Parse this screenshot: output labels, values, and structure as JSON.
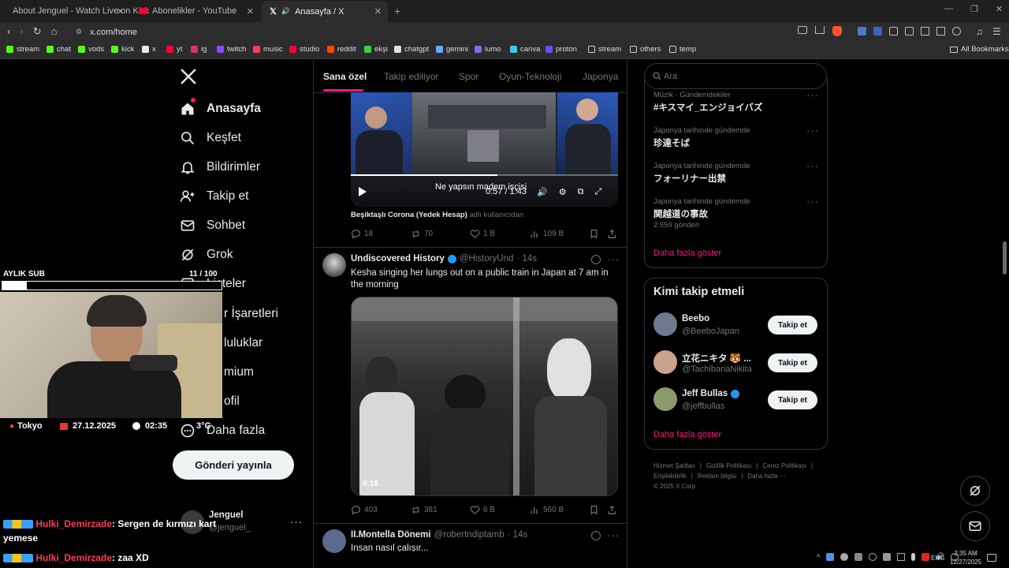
{
  "browser": {
    "tabs": [
      {
        "title": "About Jenguel - Watch Live on Kick",
        "active": false
      },
      {
        "title": "Abonelikler - YouTube",
        "active": false
      },
      {
        "title": "Anasayfa / X",
        "active": true
      }
    ],
    "url": "x.com/home",
    "bookmarks": [
      "stream",
      "chat",
      "vods",
      "kick",
      "x",
      "yt",
      "ig",
      "twitch",
      "music",
      "studio",
      "reddit",
      "ekşi",
      "chatgpt",
      "gemini",
      "lumo",
      "canva",
      "proton",
      "stream",
      "others",
      "temp"
    ],
    "all_bookmarks": "All Bookmarks"
  },
  "nav": {
    "home": "Anasayfa",
    "explore": "Keşfet",
    "notifications": "Bildirimler",
    "follow": "Takip et",
    "chat": "Sohbet",
    "grok": "Grok",
    "lists": "Listeler",
    "bookmarks": "r İşaretleri",
    "communities": "luluklar",
    "premium": "mium",
    "profile": "ofil",
    "more": "Daha fazla",
    "post_button": "Gönderi yayınla",
    "account_name": "Jenguel",
    "account_handle": "@jenguel_"
  },
  "feed": {
    "tabs": [
      "Sana özel",
      "Takip ediliyor",
      "Spor",
      "Oyun-Teknoloji",
      "Japonya"
    ],
    "post1": {
      "caption": "Ne yapsın madem işçisi",
      "time": "0:57 / 1:43",
      "attribution_user": "Beşiktaşlı Corona (Yedek Hesap)",
      "attribution_suffix": "adlı kullanıcıdan",
      "replies": "18",
      "reposts": "70",
      "likes": "1 B",
      "views": "109 B",
      "progress": 0.55
    },
    "post2": {
      "name": "Undiscovered History",
      "handle": "@HistoryUnd",
      "age": "· 14s",
      "text": "Kesha singing her lungs out on a public train in Japan at 7 am in the morning",
      "video_time": "0:16",
      "replies": "403",
      "reposts": "381",
      "likes": "6 B",
      "views": "560 B"
    },
    "post3": {
      "name": "II.Montella Dönemi",
      "handle": "@robertndiptamb",
      "age": "· 14s",
      "text": "İnsan nasıl çalışır..."
    }
  },
  "sidebar": {
    "search_placeholder": "Ara",
    "trends": [
      {
        "meta": "Müzik · Gündemdekiler",
        "title": "#キスマイ_エンジョイバズ",
        "count": ""
      },
      {
        "meta": "Japonya tarihinde gündemde",
        "title": "珍達そば",
        "count": ""
      },
      {
        "meta": "Japonya tarihinde gündemde",
        "title": "フォーリナー出禁",
        "count": ""
      },
      {
        "meta": "Japonya tarihinde gündemde",
        "title": "関越道の事故",
        "count": "2.559 gönderi"
      }
    ],
    "show_more": "Daha fazla göster",
    "who_to_follow_title": "Kimi takip etmeli",
    "who_to_follow": [
      {
        "name": "Beebo",
        "handle": "@BeeboJapan",
        "button": "Takip et"
      },
      {
        "name": "立花ニキタ 🐯 ...",
        "handle": "@TachibanaNikita",
        "button": "Takip et"
      },
      {
        "name": "Jeff Bullas",
        "handle": "@jeffbullas",
        "button": "Takip et"
      }
    ],
    "show_more2": "Daha fazla göster",
    "footer": [
      "Hizmet Şartları",
      "|",
      "Gizlilik Politikası",
      "|",
      "Çerez Politikası",
      "|",
      "Erişilebilirlik",
      "|",
      "Reklam bilgisi",
      "|",
      "Daha fazla ···",
      "© 2025 X Corp."
    ]
  },
  "overlay": {
    "sub_label": "AYLIK SUB",
    "sub_count": "11 / 100",
    "sub_progress": 0.11,
    "location": "Tokyo",
    "date": "27.12.2025",
    "time": "02:35",
    "temp": "3°C",
    "chat": [
      {
        "user": "Hulki_Demirzade",
        "message": ": Sergen de kırmızı kart yemese"
      },
      {
        "user": "Hulki_Demirzade",
        "message": ": zaa XD"
      }
    ]
  },
  "taskbar": {
    "lang": "ENG",
    "clock_time": "2:35 AM",
    "clock_date": "12/27/2025"
  },
  "colors": {
    "accent_pink": "#f91880",
    "verified_blue": "#1d9bf0",
    "chat_user": "#ff3b5c"
  }
}
